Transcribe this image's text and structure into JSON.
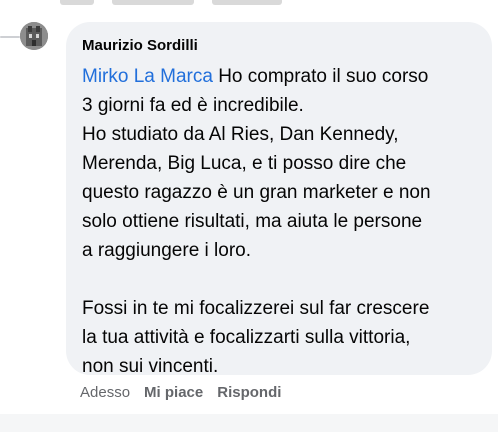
{
  "comment": {
    "author": "Maurizio Sordilli",
    "mention": "Mirko La Marca",
    "lines_first": [
      " Ho comprato il suo corso",
      "3 giorni fa ed è incredibile.",
      "Ho studiato da Al Ries, Dan Kennedy,",
      "Merenda, Big Luca, e ti posso dire che",
      "questo ragazzo è un gran marketer e non",
      "solo ottiene risultati, ma aiuta le persone",
      "a raggiungere i loro."
    ],
    "lines_second": [
      "Fossi in te mi focalizzerei sul far crescere",
      "la tua attività e focalizzarti sulla vittoria,",
      "non sui vincenti."
    ]
  },
  "actions": {
    "time": "Adesso",
    "like": "Mi piace",
    "reply": "Rispondi"
  },
  "colors": {
    "bubble": "#f0f2f5",
    "mention": "#216fdb",
    "secondary_text": "#65676b"
  }
}
